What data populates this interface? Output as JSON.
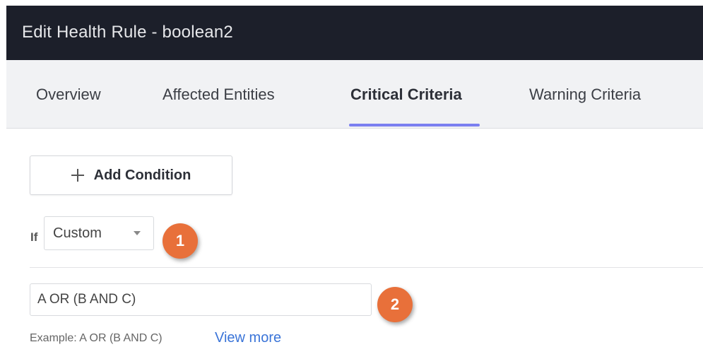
{
  "window": {
    "title": "Edit Health Rule - boolean2"
  },
  "tabs": [
    {
      "label": "Overview",
      "active": false
    },
    {
      "label": "Affected Entities",
      "active": false
    },
    {
      "label": "Critical Criteria",
      "active": true
    },
    {
      "label": "Warning Criteria",
      "active": false
    }
  ],
  "condition": {
    "add_button_label": "Add Condition",
    "if_label": "If",
    "selected_option": "Custom",
    "expression_value": "A OR (B AND C)",
    "example_text": "Example: A OR (B AND C)",
    "view_more_label": "View more"
  },
  "callouts": {
    "first": "1",
    "second": "2"
  },
  "colors": {
    "titlebar": "#1c1f2a",
    "tab_underline": "#7b7ff0",
    "callout": "#e8703a",
    "link": "#3a74d8"
  },
  "icons": {
    "add": "plus-icon",
    "dropdown": "caret-down-icon"
  }
}
